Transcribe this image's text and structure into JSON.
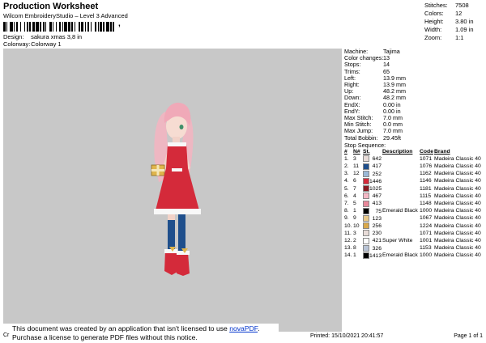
{
  "header": {
    "title": "Production Worksheet",
    "subtitle": "Wilcom EmbroideryStudio – Level 3 Advanced",
    "design_label": "Design:",
    "design_value": "sakura xmas 3,8 in",
    "colorway_label": "Colorway:",
    "colorway_value": "Colorway 1",
    "barcode_suffix": ","
  },
  "top_stats": [
    {
      "label": "Stitches:",
      "value": "7508"
    },
    {
      "label": "Colors:",
      "value": "12"
    },
    {
      "label": "Height:",
      "value": "3.80 in"
    },
    {
      "label": "Width:",
      "value": "1.09 in"
    },
    {
      "label": "Zoom:",
      "value": "1:1"
    }
  ],
  "machine_info": [
    {
      "label": "Machine:",
      "value": "Tajima"
    },
    {
      "label": "Color changes:",
      "value": "13"
    },
    {
      "label": "Stops:",
      "value": "14"
    },
    {
      "label": "Trims:",
      "value": "65"
    },
    {
      "label": "Left:",
      "value": "13.9 mm"
    },
    {
      "label": "Right:",
      "value": "13.9 mm"
    },
    {
      "label": "Up:",
      "value": "48.2 mm"
    },
    {
      "label": "Down:",
      "value": "48.2 mm"
    },
    {
      "label": "EndX:",
      "value": "0.00 in"
    },
    {
      "label": "EndY:",
      "value": "0.00 in"
    },
    {
      "label": "Max Stitch:",
      "value": "7.0 mm"
    },
    {
      "label": "Min Stitch:",
      "value": "0.0 mm"
    },
    {
      "label": "Max Jump:",
      "value": "7.0 mm"
    },
    {
      "label": "Total Bobbin:",
      "value": "29.45ft"
    }
  ],
  "stop_sequence": {
    "title": "Stop Sequence:",
    "columns": [
      "#",
      "N#",
      "St.",
      "Description",
      "Code",
      "Brand"
    ],
    "rows": [
      {
        "num": "1.",
        "n": "3",
        "color": "#e8dcd8",
        "st": "642",
        "desc": "",
        "code": "1071",
        "brand": "Madeira Classic 40"
      },
      {
        "num": "2.",
        "n": "11",
        "color": "#1f4f8c",
        "st": "417",
        "desc": "",
        "code": "1076",
        "brand": "Madeira Classic 40"
      },
      {
        "num": "3.",
        "n": "12",
        "color": "#9bb8d6",
        "st": "252",
        "desc": "",
        "code": "1162",
        "brand": "Madeira Classic 40"
      },
      {
        "num": "4.",
        "n": "6",
        "color": "#d42a3a",
        "st": "1446",
        "desc": "",
        "code": "1146",
        "brand": "Madeira Classic 40"
      },
      {
        "num": "5.",
        "n": "7",
        "color": "#8a1a22",
        "st": "1025",
        "desc": "",
        "code": "1181",
        "brand": "Madeira Classic 40"
      },
      {
        "num": "6.",
        "n": "4",
        "color": "#f4b7c4",
        "st": "467",
        "desc": "",
        "code": "1115",
        "brand": "Madeira Classic 40"
      },
      {
        "num": "7.",
        "n": "5",
        "color": "#e8889a",
        "st": "413",
        "desc": "",
        "code": "1148",
        "brand": "Madeira Classic 40"
      },
      {
        "num": "8.",
        "n": "1",
        "color": "#000000",
        "st": "75",
        "desc": "Emerald Black",
        "code": "1000",
        "brand": "Madeira Classic 40"
      },
      {
        "num": "9.",
        "n": "9",
        "color": "#e8c98a",
        "st": "123",
        "desc": "",
        "code": "1067",
        "brand": "Madeira Classic 40"
      },
      {
        "num": "10.",
        "n": "10",
        "color": "#d9a84a",
        "st": "256",
        "desc": "",
        "code": "1224",
        "brand": "Madeira Classic 40"
      },
      {
        "num": "11.",
        "n": "3",
        "color": "#e8dcd8",
        "st": "230",
        "desc": "",
        "code": "1071",
        "brand": "Madeira Classic 40"
      },
      {
        "num": "12.",
        "n": "2",
        "color": "#ffffff",
        "st": "421",
        "desc": "Super White",
        "code": "1001",
        "brand": "Madeira Classic 40"
      },
      {
        "num": "13.",
        "n": "8",
        "color": "#b9c4d6",
        "st": "326",
        "desc": "",
        "code": "1153",
        "brand": "Madeira Classic 40"
      },
      {
        "num": "14.",
        "n": "1",
        "color": "#000000",
        "st": "1413",
        "desc": "Emerald Black",
        "code": "1000",
        "brand": "Madeira Classic 40"
      }
    ]
  },
  "notice": {
    "prefix": "Cr",
    "line1": "This document was created by an application that isn't licensed to use ",
    "link": "novaPDF",
    "line1_end": ".",
    "line2": "Purchase a license to generate PDF files without this notice."
  },
  "footer": {
    "printed": "Printed: 15/10/2021 20:41:57",
    "page": "Page 1 of 1"
  },
  "colors": {
    "design_background": "#c8c8c8",
    "link": "#0033cc"
  }
}
